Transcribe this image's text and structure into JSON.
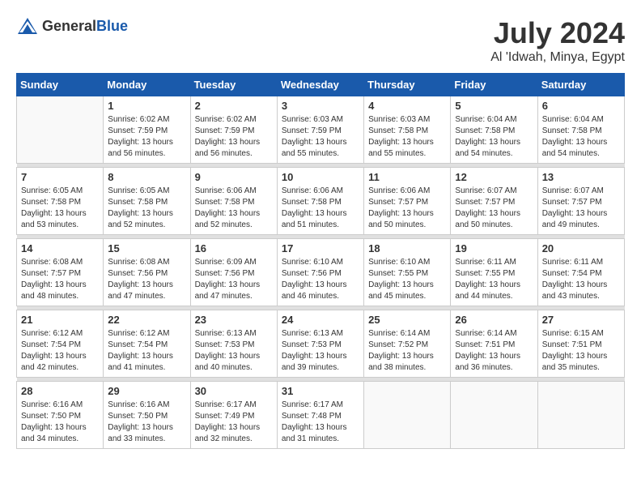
{
  "header": {
    "logo_general": "General",
    "logo_blue": "Blue",
    "title": "July 2024",
    "subtitle": "Al 'Idwah, Minya, Egypt"
  },
  "calendar": {
    "days_of_week": [
      "Sunday",
      "Monday",
      "Tuesday",
      "Wednesday",
      "Thursday",
      "Friday",
      "Saturday"
    ],
    "weeks": [
      [
        {
          "day": "",
          "sunrise": "",
          "sunset": "",
          "daylight": ""
        },
        {
          "day": "1",
          "sunrise": "6:02 AM",
          "sunset": "7:59 PM",
          "daylight": "13 hours and 56 minutes."
        },
        {
          "day": "2",
          "sunrise": "6:02 AM",
          "sunset": "7:59 PM",
          "daylight": "13 hours and 56 minutes."
        },
        {
          "day": "3",
          "sunrise": "6:03 AM",
          "sunset": "7:59 PM",
          "daylight": "13 hours and 55 minutes."
        },
        {
          "day": "4",
          "sunrise": "6:03 AM",
          "sunset": "7:58 PM",
          "daylight": "13 hours and 55 minutes."
        },
        {
          "day": "5",
          "sunrise": "6:04 AM",
          "sunset": "7:58 PM",
          "daylight": "13 hours and 54 minutes."
        },
        {
          "day": "6",
          "sunrise": "6:04 AM",
          "sunset": "7:58 PM",
          "daylight": "13 hours and 54 minutes."
        }
      ],
      [
        {
          "day": "7",
          "sunrise": "6:05 AM",
          "sunset": "7:58 PM",
          "daylight": "13 hours and 53 minutes."
        },
        {
          "day": "8",
          "sunrise": "6:05 AM",
          "sunset": "7:58 PM",
          "daylight": "13 hours and 52 minutes."
        },
        {
          "day": "9",
          "sunrise": "6:06 AM",
          "sunset": "7:58 PM",
          "daylight": "13 hours and 52 minutes."
        },
        {
          "day": "10",
          "sunrise": "6:06 AM",
          "sunset": "7:58 PM",
          "daylight": "13 hours and 51 minutes."
        },
        {
          "day": "11",
          "sunrise": "6:06 AM",
          "sunset": "7:57 PM",
          "daylight": "13 hours and 50 minutes."
        },
        {
          "day": "12",
          "sunrise": "6:07 AM",
          "sunset": "7:57 PM",
          "daylight": "13 hours and 50 minutes."
        },
        {
          "day": "13",
          "sunrise": "6:07 AM",
          "sunset": "7:57 PM",
          "daylight": "13 hours and 49 minutes."
        }
      ],
      [
        {
          "day": "14",
          "sunrise": "6:08 AM",
          "sunset": "7:57 PM",
          "daylight": "13 hours and 48 minutes."
        },
        {
          "day": "15",
          "sunrise": "6:08 AM",
          "sunset": "7:56 PM",
          "daylight": "13 hours and 47 minutes."
        },
        {
          "day": "16",
          "sunrise": "6:09 AM",
          "sunset": "7:56 PM",
          "daylight": "13 hours and 47 minutes."
        },
        {
          "day": "17",
          "sunrise": "6:10 AM",
          "sunset": "7:56 PM",
          "daylight": "13 hours and 46 minutes."
        },
        {
          "day": "18",
          "sunrise": "6:10 AM",
          "sunset": "7:55 PM",
          "daylight": "13 hours and 45 minutes."
        },
        {
          "day": "19",
          "sunrise": "6:11 AM",
          "sunset": "7:55 PM",
          "daylight": "13 hours and 44 minutes."
        },
        {
          "day": "20",
          "sunrise": "6:11 AM",
          "sunset": "7:54 PM",
          "daylight": "13 hours and 43 minutes."
        }
      ],
      [
        {
          "day": "21",
          "sunrise": "6:12 AM",
          "sunset": "7:54 PM",
          "daylight": "13 hours and 42 minutes."
        },
        {
          "day": "22",
          "sunrise": "6:12 AM",
          "sunset": "7:54 PM",
          "daylight": "13 hours and 41 minutes."
        },
        {
          "day": "23",
          "sunrise": "6:13 AM",
          "sunset": "7:53 PM",
          "daylight": "13 hours and 40 minutes."
        },
        {
          "day": "24",
          "sunrise": "6:13 AM",
          "sunset": "7:53 PM",
          "daylight": "13 hours and 39 minutes."
        },
        {
          "day": "25",
          "sunrise": "6:14 AM",
          "sunset": "7:52 PM",
          "daylight": "13 hours and 38 minutes."
        },
        {
          "day": "26",
          "sunrise": "6:14 AM",
          "sunset": "7:51 PM",
          "daylight": "13 hours and 36 minutes."
        },
        {
          "day": "27",
          "sunrise": "6:15 AM",
          "sunset": "7:51 PM",
          "daylight": "13 hours and 35 minutes."
        }
      ],
      [
        {
          "day": "28",
          "sunrise": "6:16 AM",
          "sunset": "7:50 PM",
          "daylight": "13 hours and 34 minutes."
        },
        {
          "day": "29",
          "sunrise": "6:16 AM",
          "sunset": "7:50 PM",
          "daylight": "13 hours and 33 minutes."
        },
        {
          "day": "30",
          "sunrise": "6:17 AM",
          "sunset": "7:49 PM",
          "daylight": "13 hours and 32 minutes."
        },
        {
          "day": "31",
          "sunrise": "6:17 AM",
          "sunset": "7:48 PM",
          "daylight": "13 hours and 31 minutes."
        },
        {
          "day": "",
          "sunrise": "",
          "sunset": "",
          "daylight": ""
        },
        {
          "day": "",
          "sunrise": "",
          "sunset": "",
          "daylight": ""
        },
        {
          "day": "",
          "sunrise": "",
          "sunset": "",
          "daylight": ""
        }
      ]
    ]
  }
}
